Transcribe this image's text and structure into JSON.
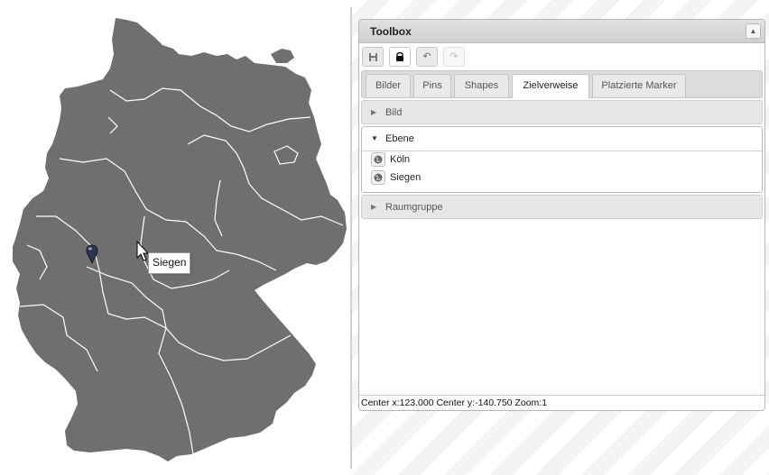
{
  "map": {
    "fill_color": "#6f6f6f",
    "border_color": "#ffffff",
    "tooltip": "Siegen",
    "marker_icon": "map-pin-icon",
    "cursor_icon": "arrow-cursor-icon"
  },
  "toolbox": {
    "title": "Toolbox",
    "collapse_icon": "chevron-up-icon",
    "toolbar": [
      {
        "name": "save-icon",
        "state": "normal"
      },
      {
        "name": "lock-icon",
        "state": "active"
      },
      {
        "name": "undo-icon",
        "state": "normal"
      },
      {
        "name": "redo-icon",
        "state": "disabled"
      }
    ],
    "tabs": [
      {
        "label": "Bilder",
        "active": false
      },
      {
        "label": "Pins",
        "active": false
      },
      {
        "label": "Shapes",
        "active": false
      },
      {
        "label": "Zielverweise",
        "active": true
      },
      {
        "label": "Platzierte Marker",
        "active": false
      }
    ],
    "sections": {
      "bild": {
        "label": "Bild",
        "expanded": false
      },
      "ebene": {
        "label": "Ebene",
        "expanded": true,
        "items": [
          {
            "label": "Köln",
            "icon": "globe-icon"
          },
          {
            "label": "Siegen",
            "icon": "globe-icon"
          }
        ]
      },
      "raumgruppe": {
        "label": "Raumgruppe",
        "expanded": false
      }
    },
    "status": "Center x:123.000 Center y:-140.750 Zoom:1"
  }
}
